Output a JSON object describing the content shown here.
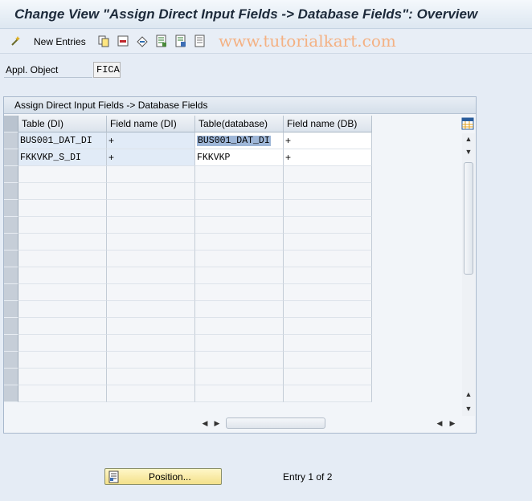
{
  "window": {
    "title": "Change View \"Assign Direct Input Fields -> Database Fields\": Overview"
  },
  "toolbar": {
    "new_entries_label": "New Entries",
    "watermark": "www.tutorialkart.com",
    "icons": [
      "new-entries-icon",
      "copy-icon",
      "delete-icon",
      "undo-icon",
      "select-all-icon",
      "select-block-icon",
      "deselect-all-icon"
    ]
  },
  "appl_object": {
    "label": "Appl. Object",
    "value": "FICA"
  },
  "table": {
    "title": "Assign Direct Input Fields -> Database Fields",
    "columns": [
      "Table (DI)",
      "Field name (DI)",
      "Table(database)",
      "Field name (DB)"
    ],
    "rows": [
      [
        "BUS001_DAT_DI",
        "+",
        "BUS001_DAT_DI",
        "+"
      ],
      [
        "FKKVKP_S_DI",
        "+",
        "FKKVKP",
        "+"
      ]
    ],
    "empty_rows": 14
  },
  "footer": {
    "position_label": "Position...",
    "entry_text": "Entry 1 of 2"
  },
  "colors": {
    "accent": "#9fb7d8",
    "button": "#f3e08a",
    "background": "#e5ecf5"
  }
}
